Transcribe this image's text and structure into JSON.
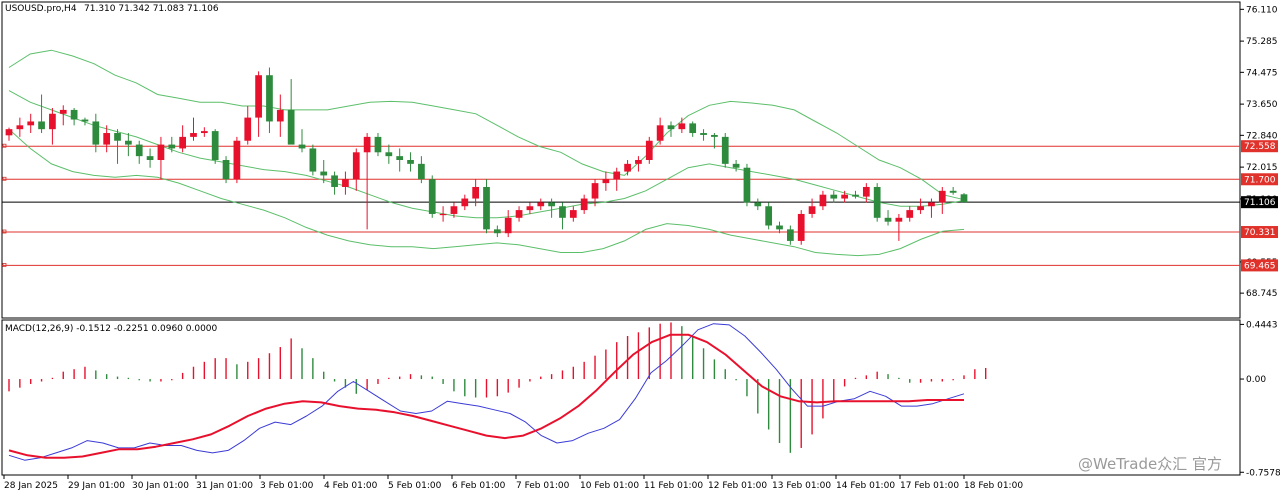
{
  "header": {
    "symbol": "USOUSD.pro,H4",
    "ohlc": "71.310 71.342 71.083 71.106"
  },
  "macd_header": {
    "label": "MACD(12,26,9) -0.1512 -0.2251 0.0960 0.0000"
  },
  "watermark": "@WeTrade众汇 官方",
  "colors": {
    "bull": "#2e8b3e",
    "bear": "#e8112d",
    "band": "#5cbf6a",
    "level": "#e0312b",
    "signal": "#e8112d",
    "macd_line": "#3b3bd6",
    "price_tag": "#000000"
  },
  "chart_data": [
    {
      "type": "candlestick",
      "price_ylim": [
        68.1,
        76.3
      ],
      "price_ticks": [
        "76.110",
        "75.285",
        "74.475",
        "73.650",
        "72.840",
        "72.015",
        "71.190",
        "69.555",
        "68.745"
      ],
      "time_labels": [
        "28 Jan 2025",
        "29 Jan 01:00",
        "30 Jan 01:00",
        "31 Jan 01:00",
        "3 Feb 01:00",
        "4 Feb 01:00",
        "5 Feb 01:00",
        "6 Feb 01:00",
        "7 Feb 01:00",
        "10 Feb 01:00",
        "11 Feb 01:00",
        "12 Feb 01:00",
        "13 Feb 01:00",
        "14 Feb 01:00",
        "17 Feb 01:00",
        "18 Feb 01:00"
      ],
      "levels": [
        {
          "value": 72.558,
          "label": "72.558"
        },
        {
          "value": 71.7,
          "label": "71.700"
        },
        {
          "value": 70.331,
          "label": "70.331"
        },
        {
          "value": 69.465,
          "label": "69.465"
        }
      ],
      "current_price": {
        "value": 71.106,
        "label": "71.106"
      },
      "candles": [
        [
          72.84,
          73.04,
          72.7,
          73.0
        ],
        [
          73.0,
          73.3,
          72.8,
          73.1
        ],
        [
          73.1,
          73.4,
          72.9,
          73.2
        ],
        [
          73.2,
          73.9,
          72.9,
          73.0
        ],
        [
          73.0,
          73.55,
          72.6,
          73.4
        ],
        [
          73.4,
          73.62,
          73.1,
          73.5
        ],
        [
          73.5,
          73.55,
          73.1,
          73.25
        ],
        [
          73.25,
          73.3,
          73.1,
          73.2
        ],
        [
          73.2,
          73.4,
          72.4,
          72.6
        ],
        [
          72.6,
          73.1,
          72.4,
          72.9
        ],
        [
          72.9,
          73.0,
          72.1,
          72.7
        ],
        [
          72.7,
          72.9,
          72.3,
          72.6
        ],
        [
          72.6,
          72.7,
          72.1,
          72.3
        ],
        [
          72.3,
          72.5,
          72.0,
          72.2
        ],
        [
          72.2,
          72.8,
          71.7,
          72.6
        ],
        [
          72.6,
          72.8,
          72.4,
          72.5
        ],
        [
          72.5,
          73.1,
          72.4,
          72.8
        ],
        [
          72.8,
          73.3,
          72.7,
          72.9
        ],
        [
          72.9,
          73.05,
          72.8,
          72.95
        ],
        [
          72.95,
          73.0,
          72.1,
          72.2
        ],
        [
          72.2,
          72.3,
          71.6,
          71.7
        ],
        [
          71.7,
          72.8,
          71.6,
          72.7
        ],
        [
          72.7,
          73.6,
          72.6,
          73.3
        ],
        [
          73.3,
          74.5,
          72.8,
          74.4
        ],
        [
          74.4,
          74.6,
          72.9,
          73.2
        ],
        [
          73.2,
          73.9,
          72.8,
          73.5
        ],
        [
          73.5,
          74.3,
          72.9,
          72.6
        ],
        [
          72.6,
          73.0,
          72.4,
          72.5
        ],
        [
          72.5,
          72.6,
          71.8,
          71.9
        ],
        [
          71.9,
          72.2,
          71.6,
          71.8
        ],
        [
          71.8,
          71.9,
          71.3,
          71.5
        ],
        [
          71.5,
          71.9,
          71.3,
          71.7
        ],
        [
          71.7,
          72.5,
          71.4,
          72.4
        ],
        [
          72.4,
          72.9,
          70.4,
          72.8
        ],
        [
          72.8,
          72.9,
          72.3,
          72.4
        ],
        [
          72.4,
          72.6,
          72.1,
          72.3
        ],
        [
          72.3,
          72.5,
          71.9,
          72.2
        ],
        [
          72.2,
          72.4,
          71.9,
          72.1
        ],
        [
          72.1,
          72.3,
          71.6,
          71.7
        ],
        [
          71.7,
          71.8,
          70.7,
          70.8
        ],
        [
          70.8,
          71.0,
          70.6,
          70.8
        ],
        [
          70.8,
          71.1,
          70.7,
          71.0
        ],
        [
          71.0,
          71.3,
          70.9,
          71.2
        ],
        [
          71.2,
          71.7,
          71.0,
          71.5
        ],
        [
          71.5,
          71.7,
          70.3,
          70.4
        ],
        [
          70.4,
          70.5,
          70.2,
          70.3
        ],
        [
          70.3,
          70.9,
          70.2,
          70.7
        ],
        [
          70.7,
          71.0,
          70.6,
          70.9
        ],
        [
          70.9,
          71.1,
          70.8,
          71.0
        ],
        [
          71.0,
          71.2,
          70.9,
          71.1
        ],
        [
          71.1,
          71.2,
          70.7,
          71.0
        ],
        [
          71.0,
          71.1,
          70.4,
          70.7
        ],
        [
          70.7,
          71.0,
          70.6,
          70.9
        ],
        [
          70.9,
          71.3,
          70.8,
          71.2
        ],
        [
          71.2,
          71.7,
          71.0,
          71.6
        ],
        [
          71.6,
          71.9,
          71.4,
          71.7
        ],
        [
          71.7,
          72.0,
          71.4,
          71.9
        ],
        [
          71.9,
          72.2,
          71.8,
          72.1
        ],
        [
          72.1,
          72.3,
          71.9,
          72.2
        ],
        [
          72.2,
          72.8,
          72.1,
          72.7
        ],
        [
          72.7,
          73.3,
          72.6,
          73.1
        ],
        [
          73.1,
          73.2,
          72.8,
          73.0
        ],
        [
          73.0,
          73.3,
          72.9,
          73.15
        ],
        [
          73.15,
          73.2,
          72.8,
          72.9
        ],
        [
          72.9,
          73.0,
          72.7,
          72.85
        ],
        [
          72.85,
          72.9,
          72.5,
          72.8
        ],
        [
          72.8,
          72.9,
          72.0,
          72.1
        ],
        [
          72.1,
          72.2,
          71.9,
          72.0
        ],
        [
          72.0,
          72.1,
          71.0,
          71.1
        ],
        [
          71.1,
          71.2,
          70.9,
          71.0
        ],
        [
          71.0,
          71.1,
          70.4,
          70.5
        ],
        [
          70.5,
          70.6,
          70.3,
          70.4
        ],
        [
          70.4,
          70.5,
          70.0,
          70.1
        ],
        [
          70.1,
          70.9,
          70.0,
          70.8
        ],
        [
          70.8,
          71.2,
          70.7,
          71.0
        ],
        [
          71.0,
          71.4,
          70.9,
          71.3
        ],
        [
          71.3,
          71.4,
          71.1,
          71.2
        ],
        [
          71.2,
          71.4,
          71.1,
          71.3
        ],
        [
          71.3,
          71.4,
          71.2,
          71.25
        ],
        [
          71.25,
          71.6,
          71.1,
          71.5
        ],
        [
          71.5,
          71.6,
          70.6,
          70.7
        ],
        [
          70.7,
          70.9,
          70.5,
          70.6
        ],
        [
          70.6,
          70.8,
          70.1,
          70.7
        ],
        [
          70.7,
          71.0,
          70.6,
          70.9
        ],
        [
          70.9,
          71.2,
          70.8,
          71.0
        ],
        [
          71.0,
          71.2,
          70.7,
          71.1
        ],
        [
          71.1,
          71.5,
          70.8,
          71.4
        ],
        [
          71.4,
          71.5,
          71.3,
          71.35
        ],
        [
          71.31,
          71.342,
          71.083,
          71.106
        ]
      ],
      "bands": {
        "upper": [
          74.6,
          74.95,
          75.05,
          74.9,
          74.7,
          74.4,
          74.2,
          73.9,
          73.8,
          73.7,
          73.7,
          73.6,
          73.6,
          73.5,
          73.5,
          73.5,
          73.6,
          73.7,
          73.72,
          73.7,
          73.6,
          73.5,
          73.4,
          73.1,
          72.8,
          72.55,
          72.4,
          72.1,
          71.9,
          71.8,
          72.3,
          72.9,
          73.35,
          73.62,
          73.72,
          73.68,
          73.62,
          73.5,
          73.2,
          72.9,
          72.55,
          72.2,
          72.0,
          71.7,
          71.3,
          71.17
        ],
        "middle": [
          74.0,
          73.7,
          73.5,
          73.3,
          73.1,
          72.95,
          72.8,
          72.6,
          72.4,
          72.25,
          72.15,
          72.05,
          71.95,
          71.9,
          71.8,
          71.65,
          71.5,
          71.3,
          71.1,
          70.95,
          70.85,
          70.75,
          70.7,
          70.7,
          70.75,
          70.85,
          70.95,
          71.05,
          71.1,
          71.2,
          71.4,
          71.7,
          72.0,
          72.1,
          72.0,
          71.9,
          71.8,
          71.7,
          71.55,
          71.4,
          71.25,
          71.1,
          71.0,
          71.0,
          71.05,
          71.15
        ],
        "lower": [
          73.0,
          72.5,
          72.1,
          71.9,
          71.8,
          71.75,
          71.8,
          71.75,
          71.6,
          71.4,
          71.2,
          71.05,
          70.9,
          70.7,
          70.45,
          70.25,
          70.1,
          70.0,
          69.95,
          69.95,
          69.9,
          69.95,
          70.0,
          70.05,
          70.0,
          69.9,
          69.8,
          69.8,
          69.9,
          70.1,
          70.4,
          70.55,
          70.5,
          70.4,
          70.25,
          70.15,
          70.05,
          69.95,
          69.8,
          69.75,
          69.72,
          69.75,
          69.9,
          70.15,
          70.35,
          70.4
        ]
      }
    },
    {
      "type": "macd",
      "title": "MACD(12,26,9) -0.1512 -0.2251 0.0960 0.0000",
      "ylim": [
        -0.78,
        0.48
      ],
      "ticks": [
        "0.4443",
        "0.00",
        "-0.7578"
      ],
      "histogram": [
        -0.1,
        -0.07,
        -0.04,
        -0.02,
        0.01,
        0.06,
        0.08,
        0.1,
        0.07,
        0.04,
        0.02,
        0.01,
        -0.01,
        -0.02,
        -0.02,
        -0.01,
        0.05,
        0.1,
        0.14,
        0.17,
        0.17,
        0.12,
        0.14,
        0.17,
        0.21,
        0.26,
        0.33,
        0.25,
        0.17,
        0.06,
        -0.02,
        -0.07,
        -0.12,
        -0.09,
        -0.04,
        0.01,
        0.02,
        0.04,
        0.03,
        0.02,
        -0.04,
        -0.1,
        -0.14,
        -0.15,
        -0.15,
        -0.14,
        -0.11,
        -0.07,
        -0.02,
        0.02,
        0.04,
        0.07,
        0.1,
        0.14,
        0.19,
        0.24,
        0.3,
        0.35,
        0.38,
        0.42,
        0.45,
        0.46,
        0.43,
        0.34,
        0.25,
        0.16,
        0.08,
        -0.01,
        -0.14,
        -0.28,
        -0.41,
        -0.52,
        -0.6,
        -0.56,
        -0.45,
        -0.32,
        -0.18,
        -0.06,
        0.01,
        0.03,
        0.06,
        0.04,
        0.01,
        -0.03,
        -0.03,
        -0.02,
        -0.02,
        -0.01,
        0.03,
        0.08,
        0.09
      ],
      "macd_line": [
        -0.62,
        -0.66,
        -0.64,
        -0.6,
        -0.56,
        -0.5,
        -0.52,
        -0.56,
        -0.56,
        -0.52,
        -0.54,
        -0.54,
        -0.58,
        -0.6,
        -0.58,
        -0.5,
        -0.4,
        -0.35,
        -0.37,
        -0.3,
        -0.22,
        -0.1,
        -0.02,
        -0.1,
        -0.18,
        -0.26,
        -0.28,
        -0.26,
        -0.18,
        -0.2,
        -0.22,
        -0.25,
        -0.28,
        -0.35,
        -0.46,
        -0.52,
        -0.5,
        -0.44,
        -0.4,
        -0.33,
        -0.16,
        0.05,
        0.15,
        0.27,
        0.4,
        0.45,
        0.44,
        0.35,
        0.22,
        0.08,
        -0.08,
        -0.22,
        -0.22,
        -0.18,
        -0.16,
        -0.1,
        -0.14,
        -0.22,
        -0.22,
        -0.2,
        -0.16,
        -0.12
      ],
      "signal_line": [
        -0.58,
        -0.62,
        -0.64,
        -0.64,
        -0.63,
        -0.6,
        -0.57,
        -0.57,
        -0.55,
        -0.52,
        -0.49,
        -0.45,
        -0.38,
        -0.3,
        -0.24,
        -0.2,
        -0.18,
        -0.19,
        -0.22,
        -0.24,
        -0.25,
        -0.27,
        -0.3,
        -0.34,
        -0.38,
        -0.42,
        -0.46,
        -0.48,
        -0.46,
        -0.4,
        -0.32,
        -0.22,
        -0.09,
        0.06,
        0.2,
        0.3,
        0.36,
        0.36,
        0.3,
        0.2,
        0.07,
        -0.06,
        -0.14,
        -0.18,
        -0.19,
        -0.18,
        -0.18,
        -0.18,
        -0.18,
        -0.18,
        -0.17,
        -0.17,
        -0.17
      ]
    }
  ]
}
